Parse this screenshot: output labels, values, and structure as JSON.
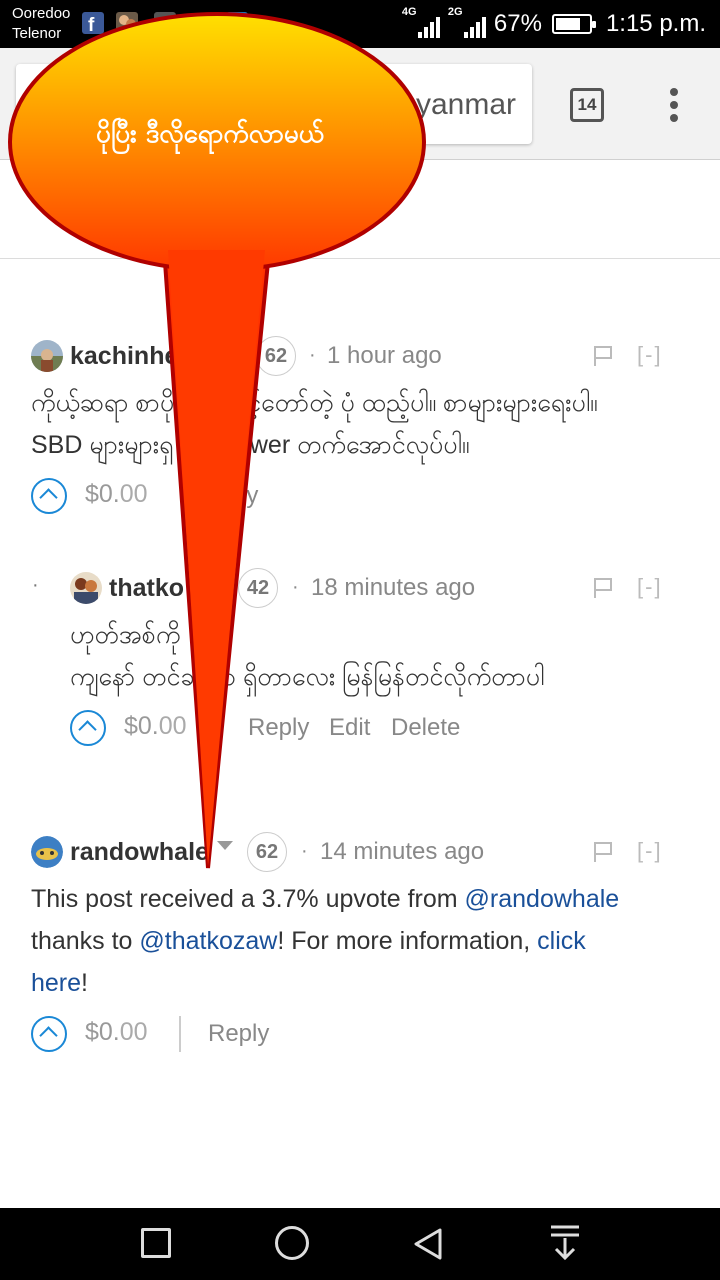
{
  "status_bar": {
    "carrier_1": "Ooredoo",
    "carrier_2": "Telenor",
    "network_1": "4G",
    "network_2": "2G",
    "battery_percent": "67%",
    "battery_level": 0.67,
    "time": "1:15 p.m."
  },
  "browser": {
    "url_visible": "yanmar",
    "tab_count": "14"
  },
  "callout": {
    "text": "ပိုပြီး ဒီလိုရောက်လာမယ်",
    "fill_top": "#ffe000",
    "fill_bottom": "#ff3800",
    "stroke": "#b00000"
  },
  "comments": [
    {
      "author": "kachinhe",
      "reputation": "62",
      "time": "1 hour ago",
      "collapse": "[-]",
      "body_lines": [
        "ကိုယ့်ဆရာ စာပို ကြီး သင့်တော်တဲ့ ပုံ ထည့်ပါ။ စာများများရေးပါ။",
        "SBD များများရှ em power တက်အောင်လုပ်ပါ။"
      ],
      "payout_prefix": "$0.",
      "payout_cents": "00",
      "reply": "ly"
    },
    {
      "author": "thatko",
      "reputation": "42",
      "time": "18 minutes ago",
      "collapse": "[-]",
      "body_lines": [
        "ဟုတ်အစ်ကို",
        "ကျနော် တင်ခ တာ ရှိတာလေး မြန်မြန်တင်လိုက်တာပါ"
      ],
      "payout_prefix": "$0.",
      "payout_cents": "00",
      "reply": "Reply",
      "edit": "Edit",
      "delete": "Delete"
    },
    {
      "author": "randowhale",
      "reputation": "62",
      "time": "14 minutes ago",
      "collapse": "[-]",
      "body": {
        "t1": "This post received a 3.7% upvote from ",
        "link1": "@randowhale",
        "t2": "thanks to ",
        "link2": "@thatkozaw",
        "t3": "! For more information, ",
        "link3a": "click",
        "link3b": "here",
        "t4": "!"
      },
      "payout_prefix": "$0.",
      "payout_cents": "00",
      "reply": "Reply"
    }
  ]
}
